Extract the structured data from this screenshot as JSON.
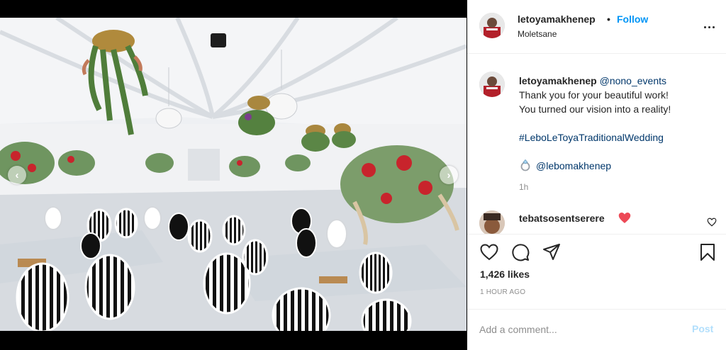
{
  "post": {
    "author": {
      "username": "letoyamakhenep",
      "follow_label": "Follow",
      "separator": "•",
      "location": "Moletsane"
    },
    "caption": {
      "username": "letoyamakhenep",
      "mention": "@nono_events",
      "line1": "Thank you for your beautiful work!",
      "line2": "You turned our vision into a reality!",
      "hashtag": "#LeboLeToyaTraditionalWedding",
      "tag": "@lebomakhenep",
      "time": "1h"
    },
    "comments": [
      {
        "username": "tebatsosentserere",
        "emoji": "red-heart-emoji"
      }
    ],
    "likes_text": "1,426 likes",
    "posted_ago": "1 HOUR AGO",
    "add_comment": {
      "placeholder": "Add a comment...",
      "post_label": "Post"
    }
  },
  "icons": {
    "carousel_prev": "chevron-left-icon",
    "carousel_next": "chevron-right-icon",
    "more": "more-options-icon",
    "like": "heart-outline-icon",
    "comment": "comment-bubble-icon",
    "share": "paper-plane-icon",
    "save": "bookmark-icon",
    "ring": "diamond-ring-icon"
  },
  "colors": {
    "follow": "#0095f6",
    "link": "#00376b",
    "post_disabled": "#b2dffc",
    "muted": "#8e8e8e",
    "heart": "#ed4956"
  }
}
